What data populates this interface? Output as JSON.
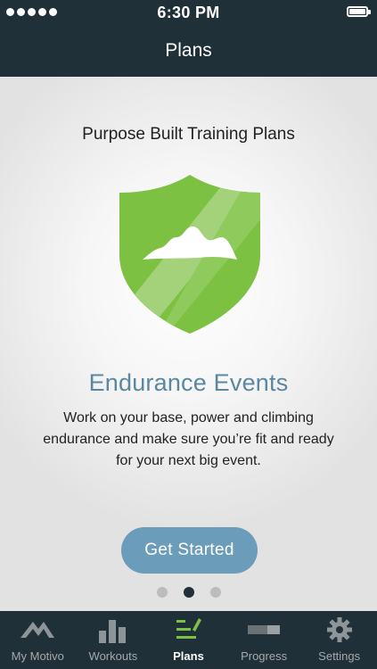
{
  "status_bar": {
    "time": "6:30 PM",
    "signal_icon": "signal-dots-icon",
    "battery_icon": "battery-icon"
  },
  "nav": {
    "title": "Plans"
  },
  "plan_card": {
    "headline": "Purpose Built Training Plans",
    "icon": "shield-mountain-icon",
    "title": "Endurance Events",
    "description": "Work on your base, power and climbing endurance and make sure you’re fit and ready for your next big event.",
    "cta_label": "Get Started"
  },
  "pager": {
    "total": 3,
    "active": 2
  },
  "tabs": [
    {
      "label": "My Motivo",
      "icon": "motivo-logo-icon",
      "active": false
    },
    {
      "label": "Workouts",
      "icon": "bar-chart-icon",
      "active": false
    },
    {
      "label": "Plans",
      "icon": "plans-list-icon",
      "active": true
    },
    {
      "label": "Progress",
      "icon": "progress-bar-icon",
      "active": false
    },
    {
      "label": "Settings",
      "icon": "gear-icon",
      "active": false
    }
  ],
  "colors": {
    "bar_background": "#1f3038",
    "accent_green": "#7dc142",
    "accent_blue": "#5c87a1",
    "button_blue": "#6b9dbb"
  }
}
